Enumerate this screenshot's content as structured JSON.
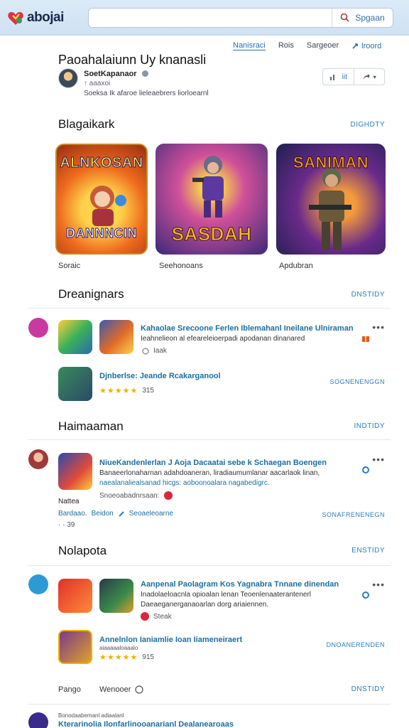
{
  "app": {
    "logo_text": "abojai"
  },
  "search": {
    "placeholder": "",
    "value": "",
    "button_label": "Spgaan"
  },
  "nav": {
    "items": [
      "Nanisraci",
      "Rois",
      "Sargeoer"
    ],
    "share": "lroord"
  },
  "page": {
    "title": "Paoahalaiunn Uy knanasli",
    "publisher": "SoetKapanaor",
    "publisher_sub": "↑ aaaxoi",
    "description": "Soeksa Ik afaroe lieleaebrers liorloearnl"
  },
  "actions": {
    "count": "iit"
  },
  "sections": {
    "featured": {
      "title": "Blagaikark",
      "view_all": "DIGHDTY",
      "cards": [
        {
          "art_top": "ALNKOSAN",
          "art_bottom": "DANNNCIN",
          "label": "Soraic"
        },
        {
          "art_top": "",
          "art_bottom": "SASDAH",
          "label": "Seehonoans"
        },
        {
          "art_top": "SANIMAN",
          "art_bottom": "",
          "label": "Apdubran"
        }
      ]
    },
    "s2": {
      "title": "Dreanignars",
      "view_all": "DNSTIDY",
      "row1": {
        "title": "Kahaolae Srecoone Ferlen Iblemahanl Ineilane Ulniraman",
        "sub": "Ieahnelieon al efeareleioerpadi apodanan dinanared",
        "small": "Iaak"
      },
      "row2": {
        "title": "Djnberlse: Jeande Rcakarganool",
        "rating": "315",
        "cta": "SOGNENENGGN"
      }
    },
    "s3": {
      "title": "Haimaaman",
      "view_all": "INDTIDY",
      "row1": {
        "title": "NiueKandenlerlan J Aoja Dacaatai sebe k Schaegan Boengen",
        "line2": "Banaeerlonaharnan adahdoaneran, liradiaumumlanar aacarlaok linan,",
        "line3": "naealanaliealsanad hicgs: aoboonoalara nagabedigrc.",
        "small": "Snoeoabadnrsaan:"
      },
      "row2": {
        "label": "Nattea",
        "meta1": "Bardaao.",
        "meta2": "Beidon",
        "meta3": "Seoaeleoarne",
        "meta4": "· · 39",
        "cta": "SONAFRENENEGN"
      }
    },
    "s4": {
      "title": "Nolapota",
      "view_all": "ENSTIDY",
      "row1": {
        "title": "Aanpenal Paolagram Kos Yagnabra Tnnane dinendan",
        "line2": "Inadolaeloacnla opioalan lenan Teoenlenaaterantenerl",
        "line3": "Daeaeganerganaoarlan dorg ariaiennen.",
        "small": "Steak"
      },
      "row2": {
        "title": "Annelnlon Ianiamlie Ioan Iiameneiraert",
        "sub": "aiaaaaaloaaalo",
        "rating": "915",
        "cta": "DNOANERENDEN"
      }
    },
    "s5": {
      "left": "Pango",
      "mid": "Wenooer",
      "view_all": "DNSTIDY"
    },
    "footer_row": {
      "title": "Kterarinolia Ilonfarlinooanarianl Dealanearoaas",
      "sub": "Bonodaabemanl adiaalanl"
    }
  },
  "colors": {
    "accent": "#2b7bbd",
    "link": "#1c6ea0",
    "star": "#f0b000",
    "topbar": "#d4e5f5"
  }
}
